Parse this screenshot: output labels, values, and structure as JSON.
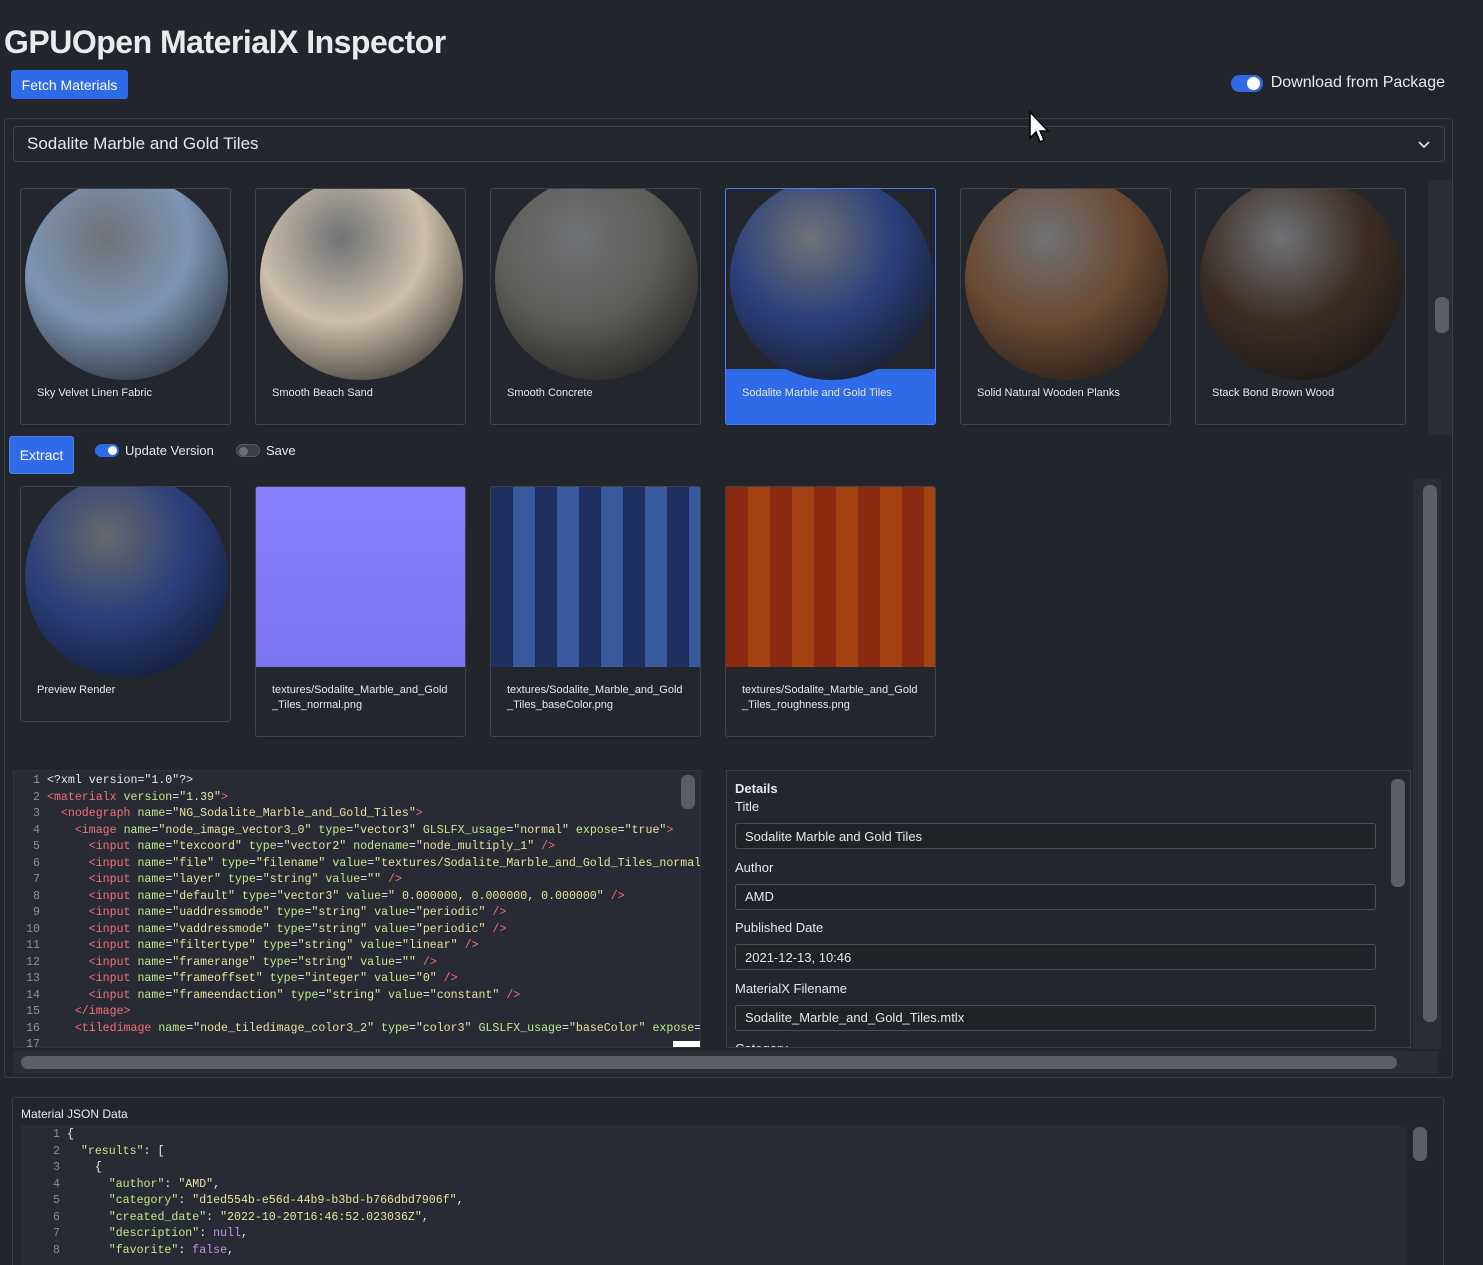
{
  "app": {
    "title": "GPUOpen MaterialX Inspector",
    "fetch_label": "Fetch Materials",
    "download_label": "Download from Package",
    "download_enabled": true
  },
  "select": {
    "value": "Sodalite Marble and Gold Tiles"
  },
  "gallery": {
    "items": [
      {
        "name": "Sky Velvet Linen Fabric",
        "color": "#7d95b5",
        "selected": false
      },
      {
        "name": "Smooth Beach Sand",
        "color": "#cbbfaa",
        "selected": false
      },
      {
        "name": "Smooth Concrete",
        "color": "#5d5c58",
        "selected": false
      },
      {
        "name": "Sodalite Marble and Gold Tiles",
        "color": "#2a3f7a",
        "selected": true
      },
      {
        "name": "Solid Natural Wooden Planks",
        "color": "#6b4a32",
        "selected": false
      },
      {
        "name": "Stack Bond Brown Wood",
        "color": "#3c2e25",
        "selected": false
      }
    ]
  },
  "extract": {
    "label": "Extract",
    "update_version_label": "Update Version",
    "update_version_on": true,
    "save_label": "Save",
    "save_on": false
  },
  "textures": {
    "items": [
      {
        "name": "Preview Render"
      },
      {
        "name": "textures/Sodalite_Marble_and_Gold_Tiles_normal.png",
        "line1": "textures/Sodalite_Marble_and_Gold",
        "line2": "_Tiles_normal.png"
      },
      {
        "name": "textures/Sodalite_Marble_and_Gold_Tiles_baseColor.png",
        "line1": "textures/Sodalite_Marble_and_Gold",
        "line2": "_Tiles_baseColor.png"
      },
      {
        "name": "textures/Sodalite_Marble_and_Gold_Tiles_roughness.png",
        "line1": "textures/Sodalite_Marble_and_Gold",
        "line2": "_Tiles_roughness.png"
      }
    ]
  },
  "code": {
    "lines": [
      {
        "n": "1",
        "html": "<span class=\"tk-plain\">&lt;?xml version=\"1.0\"?&gt;</span>"
      },
      {
        "n": "2",
        "html": "<span class=\"tk-tag\">&lt;materialx</span> <span class=\"tk-attr\">version</span><span class=\"tk-plain\">=</span><span class=\"tk-str\">\"1.39\"</span><span class=\"tk-tag\">&gt;</span>"
      },
      {
        "n": "3",
        "html": "  <span class=\"tk-tag\">&lt;nodegraph</span> <span class=\"tk-attr\">name</span><span class=\"tk-plain\">=</span><span class=\"tk-str\">\"NG_Sodalite_Marble_and_Gold_Tiles\"</span><span class=\"tk-tag\">&gt;</span>"
      },
      {
        "n": "4",
        "html": "    <span class=\"tk-tag\">&lt;image</span> <span class=\"tk-attr\">name</span><span class=\"tk-plain\">=</span><span class=\"tk-str\">\"node_image_vector3_0\"</span> <span class=\"tk-attr\">type</span><span class=\"tk-plain\">=</span><span class=\"tk-str\">\"vector3\"</span> <span class=\"tk-attr\">GLSLFX_usage</span><span class=\"tk-plain\">=</span><span class=\"tk-str\">\"normal\"</span> <span class=\"tk-attr\">expose</span><span class=\"tk-plain\">=</span><span class=\"tk-str\">\"true\"</span><span class=\"tk-tag\">&gt;</span>"
      },
      {
        "n": "5",
        "html": "      <span class=\"tk-tag\">&lt;input</span> <span class=\"tk-attr\">name</span><span class=\"tk-plain\">=</span><span class=\"tk-str\">\"texcoord\"</span> <span class=\"tk-attr\">type</span><span class=\"tk-plain\">=</span><span class=\"tk-str\">\"vector2\"</span> <span class=\"tk-attr\">nodename</span><span class=\"tk-plain\">=</span><span class=\"tk-str\">\"node_multiply_1\"</span> <span class=\"tk-tag\">/&gt;</span>"
      },
      {
        "n": "6",
        "html": "      <span class=\"tk-tag\">&lt;input</span> <span class=\"tk-attr\">name</span><span class=\"tk-plain\">=</span><span class=\"tk-str\">\"file\"</span> <span class=\"tk-attr\">type</span><span class=\"tk-plain\">=</span><span class=\"tk-str\">\"filename\"</span> <span class=\"tk-attr\">value</span><span class=\"tk-plain\">=</span><span class=\"tk-str\">\"textures/Sodalite_Marble_and_Gold_Tiles_normal.</span>"
      },
      {
        "n": "7",
        "html": "      <span class=\"tk-tag\">&lt;input</span> <span class=\"tk-attr\">name</span><span class=\"tk-plain\">=</span><span class=\"tk-str\">\"layer\"</span> <span class=\"tk-attr\">type</span><span class=\"tk-plain\">=</span><span class=\"tk-str\">\"string\"</span> <span class=\"tk-attr\">value</span><span class=\"tk-plain\">=</span><span class=\"tk-str\">\"\"</span> <span class=\"tk-tag\">/&gt;</span>"
      },
      {
        "n": "8",
        "html": "      <span class=\"tk-tag\">&lt;input</span> <span class=\"tk-attr\">name</span><span class=\"tk-plain\">=</span><span class=\"tk-str\">\"default\"</span> <span class=\"tk-attr\">type</span><span class=\"tk-plain\">=</span><span class=\"tk-str\">\"vector3\"</span> <span class=\"tk-attr\">value</span><span class=\"tk-plain\">=</span><span class=\"tk-str\">\" 0.000000, 0.000000, 0.000000\"</span> <span class=\"tk-tag\">/&gt;</span>"
      },
      {
        "n": "9",
        "html": "      <span class=\"tk-tag\">&lt;input</span> <span class=\"tk-attr\">name</span><span class=\"tk-plain\">=</span><span class=\"tk-str\">\"uaddressmode\"</span> <span class=\"tk-attr\">type</span><span class=\"tk-plain\">=</span><span class=\"tk-str\">\"string\"</span> <span class=\"tk-attr\">value</span><span class=\"tk-plain\">=</span><span class=\"tk-str\">\"periodic\"</span> <span class=\"tk-tag\">/&gt;</span>"
      },
      {
        "n": "10",
        "html": "      <span class=\"tk-tag\">&lt;input</span> <span class=\"tk-attr\">name</span><span class=\"tk-plain\">=</span><span class=\"tk-str\">\"vaddressmode\"</span> <span class=\"tk-attr\">type</span><span class=\"tk-plain\">=</span><span class=\"tk-str\">\"string\"</span> <span class=\"tk-attr\">value</span><span class=\"tk-plain\">=</span><span class=\"tk-str\">\"periodic\"</span> <span class=\"tk-tag\">/&gt;</span>"
      },
      {
        "n": "11",
        "html": "      <span class=\"tk-tag\">&lt;input</span> <span class=\"tk-attr\">name</span><span class=\"tk-plain\">=</span><span class=\"tk-str\">\"filtertype\"</span> <span class=\"tk-attr\">type</span><span class=\"tk-plain\">=</span><span class=\"tk-str\">\"string\"</span> <span class=\"tk-attr\">value</span><span class=\"tk-plain\">=</span><span class=\"tk-str\">\"linear\"</span> <span class=\"tk-tag\">/&gt;</span>"
      },
      {
        "n": "12",
        "html": "      <span class=\"tk-tag\">&lt;input</span> <span class=\"tk-attr\">name</span><span class=\"tk-plain\">=</span><span class=\"tk-str\">\"framerange\"</span> <span class=\"tk-attr\">type</span><span class=\"tk-plain\">=</span><span class=\"tk-str\">\"string\"</span> <span class=\"tk-attr\">value</span><span class=\"tk-plain\">=</span><span class=\"tk-str\">\"\"</span> <span class=\"tk-tag\">/&gt;</span>"
      },
      {
        "n": "13",
        "html": "      <span class=\"tk-tag\">&lt;input</span> <span class=\"tk-attr\">name</span><span class=\"tk-plain\">=</span><span class=\"tk-str\">\"frameoffset\"</span> <span class=\"tk-attr\">type</span><span class=\"tk-plain\">=</span><span class=\"tk-str\">\"integer\"</span> <span class=\"tk-attr\">value</span><span class=\"tk-plain\">=</span><span class=\"tk-str\">\"0\"</span> <span class=\"tk-tag\">/&gt;</span>"
      },
      {
        "n": "14",
        "html": "      <span class=\"tk-tag\">&lt;input</span> <span class=\"tk-attr\">name</span><span class=\"tk-plain\">=</span><span class=\"tk-str\">\"frameendaction\"</span> <span class=\"tk-attr\">type</span><span class=\"tk-plain\">=</span><span class=\"tk-str\">\"string\"</span> <span class=\"tk-attr\">value</span><span class=\"tk-plain\">=</span><span class=\"tk-str\">\"constant\"</span> <span class=\"tk-tag\">/&gt;</span>"
      },
      {
        "n": "15",
        "html": "    <span class=\"tk-tag\">&lt;/image&gt;</span>"
      },
      {
        "n": "16",
        "html": "    <span class=\"tk-tag\">&lt;tiledimage</span> <span class=\"tk-attr\">name</span><span class=\"tk-plain\">=</span><span class=\"tk-str\">\"node_tiledimage_color3_2\"</span> <span class=\"tk-attr\">type</span><span class=\"tk-plain\">=</span><span class=\"tk-str\">\"color3\"</span> <span class=\"tk-attr\">GLSLFX_usage</span><span class=\"tk-plain\">=</span><span class=\"tk-str\">\"baseColor\"</span> <span class=\"tk-attr\">expose</span><span class=\"tk-plain\">=</span><span class=\"tk-str\">\"</span>"
      },
      {
        "n": "17",
        "html": ""
      }
    ]
  },
  "details": {
    "heading": "Details",
    "fields": [
      {
        "label": "Title",
        "value": "Sodalite Marble and Gold Tiles"
      },
      {
        "label": "Author",
        "value": "AMD"
      },
      {
        "label": "Published Date",
        "value": "2021-12-13, 10:46"
      },
      {
        "label": "MaterialX Filename",
        "value": "Sodalite_Marble_and_Gold_Tiles.mtlx"
      },
      {
        "label": "Category",
        "value": ""
      }
    ]
  },
  "json_panel": {
    "title": "Material JSON Data",
    "lines": [
      {
        "n": "1",
        "html": "<span class=\"tk-plain\">{</span>"
      },
      {
        "n": "2",
        "html": "  <span class=\"tk-key\">\"results\"</span><span class=\"tk-plain\">: [</span>"
      },
      {
        "n": "3",
        "html": "    <span class=\"tk-plain\">{</span>"
      },
      {
        "n": "4",
        "html": "      <span class=\"tk-key\">\"author\"</span><span class=\"tk-plain\">: </span><span class=\"tk-val\">\"AMD\"</span><span class=\"tk-plain\">,</span>"
      },
      {
        "n": "5",
        "html": "      <span class=\"tk-key\">\"category\"</span><span class=\"tk-plain\">: </span><span class=\"tk-val\">\"d1ed554b-e56d-44b9-b3bd-b766dbd7906f\"</span><span class=\"tk-plain\">,</span>"
      },
      {
        "n": "6",
        "html": "      <span class=\"tk-key\">\"created_date\"</span><span class=\"tk-plain\">: </span><span class=\"tk-val\">\"2022-10-20T16:46:52.023036Z\"</span><span class=\"tk-plain\">,</span>"
      },
      {
        "n": "7",
        "html": "      <span class=\"tk-key\">\"description\"</span><span class=\"tk-plain\">: </span><span class=\"tk-kw\">null</span><span class=\"tk-plain\">,</span>"
      },
      {
        "n": "8",
        "html": "      <span class=\"tk-key\">\"favorite\"</span><span class=\"tk-plain\">: </span><span class=\"tk-kw\">false</span><span class=\"tk-plain\">,</span>"
      }
    ]
  },
  "colors": {
    "accent": "#2f6ae8",
    "background": "#22262c"
  }
}
